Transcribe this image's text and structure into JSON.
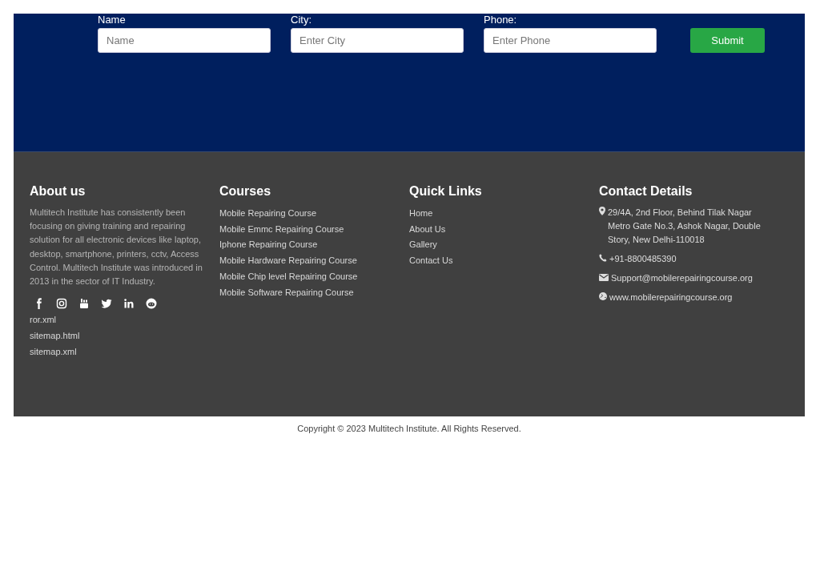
{
  "form": {
    "fields": [
      {
        "label": "Name",
        "placeholder": "Name"
      },
      {
        "label": "City:",
        "placeholder": "Enter City"
      },
      {
        "label": "Phone:",
        "placeholder": "Enter Phone"
      }
    ],
    "submit": "Submit"
  },
  "footer": {
    "about": {
      "title": "About us",
      "text": "Multitech Institute has consistently been focusing on giving training and repairing solution for all electronic devices like laptop, desktop, smartphone, printers, cctv, Access Control. Multitech Institute was introduced in 2013 in the sector of IT Industry.",
      "links": [
        "ror.xml",
        "sitemap.html",
        "sitemap.xml"
      ]
    },
    "courses": {
      "title": "Courses",
      "links": [
        "Mobile Repairing Course",
        "Mobile Emmc Repairing Course",
        "Iphone Repairing Course",
        "Mobile Hardware Repairing Course",
        "Mobile Chip level Repairing Course",
        "Mobile Software Repairing Course"
      ]
    },
    "quick_links": {
      "title": "Quick Links",
      "links": [
        "Home",
        "About Us",
        "Gallery",
        "Contact Us"
      ]
    },
    "contact": {
      "title": "Contact Details",
      "items": [
        {
          "kind": "address",
          "text": "29/4A, 2nd Floor, Behind Tilak Nagar Metro Gate No.3, Ashok Nagar, Double Story, New Delhi-110018"
        },
        {
          "kind": "phone",
          "text": "+91-8800485390"
        },
        {
          "kind": "email",
          "text": "Support@mobilerepairingcourse.org"
        },
        {
          "kind": "web",
          "text": "www.mobilerepairingcourse.org"
        }
      ]
    }
  },
  "copyright": "Copyright © 2023 Multitech Institute. All Rights Reserved."
}
